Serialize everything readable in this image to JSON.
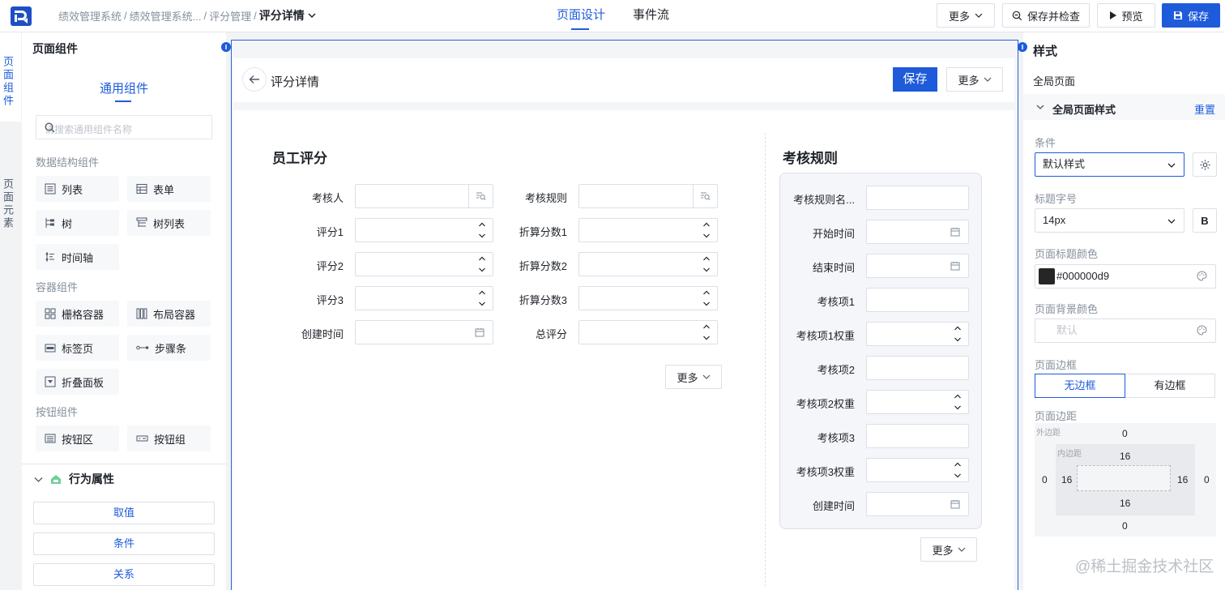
{
  "breadcrumb": {
    "items": [
      "绩效管理系统",
      "绩效管理系统...",
      "评分管理"
    ],
    "current": "评分详情"
  },
  "main_tabs": [
    "页面设计",
    "事件流"
  ],
  "toolbar": {
    "more": "更多",
    "save_check": "保存并检查",
    "preview": "预览",
    "save": "保存"
  },
  "side_tabs": [
    "页面组件",
    "页面元素"
  ],
  "left_panel": {
    "title": "页面组件",
    "tab": "通用组件",
    "search_placeholder": "请搜索通用组件名称",
    "groups": [
      {
        "title": "数据结构组件",
        "items": [
          {
            "label": "列表",
            "icon": "list-icon"
          },
          {
            "label": "表单",
            "icon": "table-icon"
          },
          {
            "label": "树",
            "icon": "tree-icon"
          },
          {
            "label": "树列表",
            "icon": "tree-list-icon"
          },
          {
            "label": "时间轴",
            "icon": "timeline-icon"
          }
        ]
      },
      {
        "title": "容器组件",
        "items": [
          {
            "label": "栅格容器",
            "icon": "grid-icon"
          },
          {
            "label": "布局容器",
            "icon": "layout-icon"
          },
          {
            "label": "标签页",
            "icon": "tab-icon"
          },
          {
            "label": "步骤条",
            "icon": "steps-icon"
          },
          {
            "label": "折叠面板",
            "icon": "collapse-icon"
          }
        ]
      },
      {
        "title": "按钮组件",
        "items": [
          {
            "label": "按钮区",
            "icon": "button-area-icon"
          },
          {
            "label": "按钮组",
            "icon": "button-group-icon"
          }
        ]
      }
    ],
    "behavior": {
      "title": "行为属性",
      "buttons": [
        "取值",
        "条件",
        "关系"
      ]
    }
  },
  "canvas": {
    "title": "评分详情",
    "save": "保存",
    "more": "更多",
    "left_section": {
      "title": "员工评分",
      "col1": [
        {
          "label": "考核人",
          "type": "lookup"
        },
        {
          "label": "评分1",
          "type": "number"
        },
        {
          "label": "评分2",
          "type": "number"
        },
        {
          "label": "评分3",
          "type": "number"
        },
        {
          "label": "创建时间",
          "type": "date"
        }
      ],
      "col2": [
        {
          "label": "考核规则",
          "type": "lookup"
        },
        {
          "label": "折算分数1",
          "type": "number"
        },
        {
          "label": "折算分数2",
          "type": "number"
        },
        {
          "label": "折算分数3",
          "type": "number"
        },
        {
          "label": "总评分",
          "type": "number"
        }
      ],
      "more": "更多"
    },
    "right_section": {
      "title": "考核规则",
      "fields": [
        {
          "label": "考核规则名...",
          "type": "text"
        },
        {
          "label": "开始时间",
          "type": "date"
        },
        {
          "label": "结束时间",
          "type": "date"
        },
        {
          "label": "考核项1",
          "type": "text"
        },
        {
          "label": "考核项1权重",
          "type": "number"
        },
        {
          "label": "考核项2",
          "type": "text"
        },
        {
          "label": "考核项2权重",
          "type": "number"
        },
        {
          "label": "考核项3",
          "type": "text"
        },
        {
          "label": "考核项3权重",
          "type": "number"
        },
        {
          "label": "创建时间",
          "type": "date"
        }
      ],
      "more": "更多"
    }
  },
  "right_panel": {
    "title": "样式",
    "sub": "全局页面",
    "section": "全局页面样式",
    "reset": "重置",
    "condition_label": "条件",
    "condition_value": "默认样式",
    "font_label": "标题字号",
    "font_value": "14px",
    "bold": "B",
    "title_color_label": "页面标题颜色",
    "title_color_value": "#000000d9",
    "bg_color_label": "页面背景颜色",
    "bg_color_placeholder": "默认",
    "border_label": "页面边框",
    "border_options": [
      "无边框",
      "有边框"
    ],
    "spacing_label": "页面边距",
    "outer_caption": "外边距",
    "inner_caption": "内边距",
    "outer": {
      "top": "0",
      "right": "0",
      "bottom": "0",
      "left": "0"
    },
    "inner": {
      "top": "16",
      "right": "16",
      "bottom": "16",
      "left": "16"
    }
  },
  "colors": {
    "accent": "#1e5bdb",
    "title_swatch": "#262626"
  },
  "watermark": "@稀土掘金技术社区"
}
